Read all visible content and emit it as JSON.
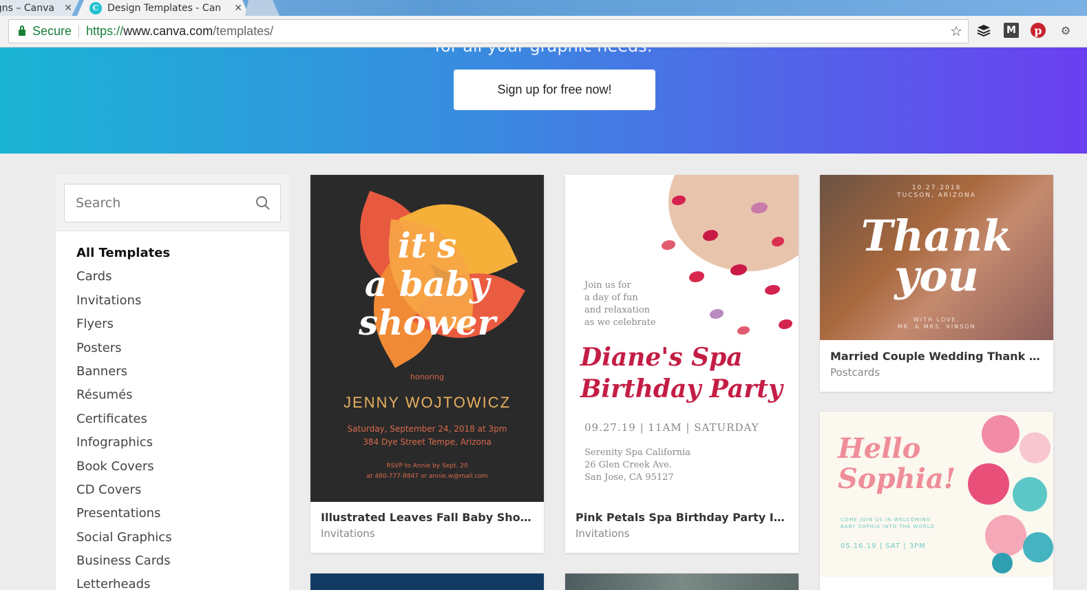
{
  "browser": {
    "tabs": [
      {
        "label": "igns – Canva"
      },
      {
        "label": "Design Templates - Canv"
      }
    ],
    "secure_label": "Secure",
    "url": {
      "scheme": "https://",
      "host": "www.canva.com",
      "path": "/templates/"
    }
  },
  "hero": {
    "subtitle": "for all your graphic needs.",
    "signup_label": "Sign up for free now!"
  },
  "sidebar": {
    "search_placeholder": "Search",
    "categories": [
      {
        "label": "All Templates",
        "active": true
      },
      {
        "label": "Cards"
      },
      {
        "label": "Invitations"
      },
      {
        "label": "Flyers"
      },
      {
        "label": "Posters"
      },
      {
        "label": "Banners"
      },
      {
        "label": "Résumés"
      },
      {
        "label": "Certificates"
      },
      {
        "label": "Infographics"
      },
      {
        "label": "Book Covers"
      },
      {
        "label": "CD Covers"
      },
      {
        "label": "Presentations"
      },
      {
        "label": "Social Graphics"
      },
      {
        "label": "Business Cards"
      },
      {
        "label": "Letterheads"
      }
    ]
  },
  "templates": [
    {
      "title": "Illustrated Leaves Fall Baby Shower I...",
      "category": "Invitations",
      "art": {
        "script_lines": [
          "it's",
          "a baby",
          "shower"
        ],
        "honoring": "honoring",
        "name": "JENNY WOJTOWICZ",
        "details": [
          "Saturday, September 24, 2018 at 3pm",
          "384 Dye Street Tempe, Arizona"
        ],
        "rsvp": [
          "RSVP to Annie by Sept. 20",
          "at 480-777-8847 or annie.w@mail.com"
        ]
      }
    },
    {
      "title": "Pink Petals Spa Birthday Party Invita...",
      "category": "Invitations",
      "art": {
        "join_lines": [
          "Join us for",
          "a day of fun",
          "and relaxation",
          "as we celebrate"
        ],
        "big_lines": [
          "Diane's Spa",
          "Birthday Party"
        ],
        "date": "09.27.19 | 11AM | SATURDAY",
        "address_lines": [
          "Serenity Spa California",
          "26 Glen Creek Ave.",
          "San Jose, CA 95127"
        ]
      }
    },
    {
      "title": "Married Couple Wedding Thank You ...",
      "category": "Postcards",
      "art": {
        "date_line": "10.27.2018",
        "location_line": "TUCSON, ARIZONA",
        "big_lines": [
          "Thank",
          "you"
        ],
        "love_line": "WITH LOVE,",
        "names_line": "MR. & MRS. VINSON"
      }
    },
    {
      "title": "",
      "category": "",
      "art": {
        "big_lines": [
          "Hello",
          "Sophia!"
        ],
        "sub_lines": [
          "COME JOIN US IN WELCOMING",
          "BABY SOPHIA INTO THE WORLD"
        ],
        "date": "05.16.19 | SAT | 3PM"
      }
    }
  ]
}
